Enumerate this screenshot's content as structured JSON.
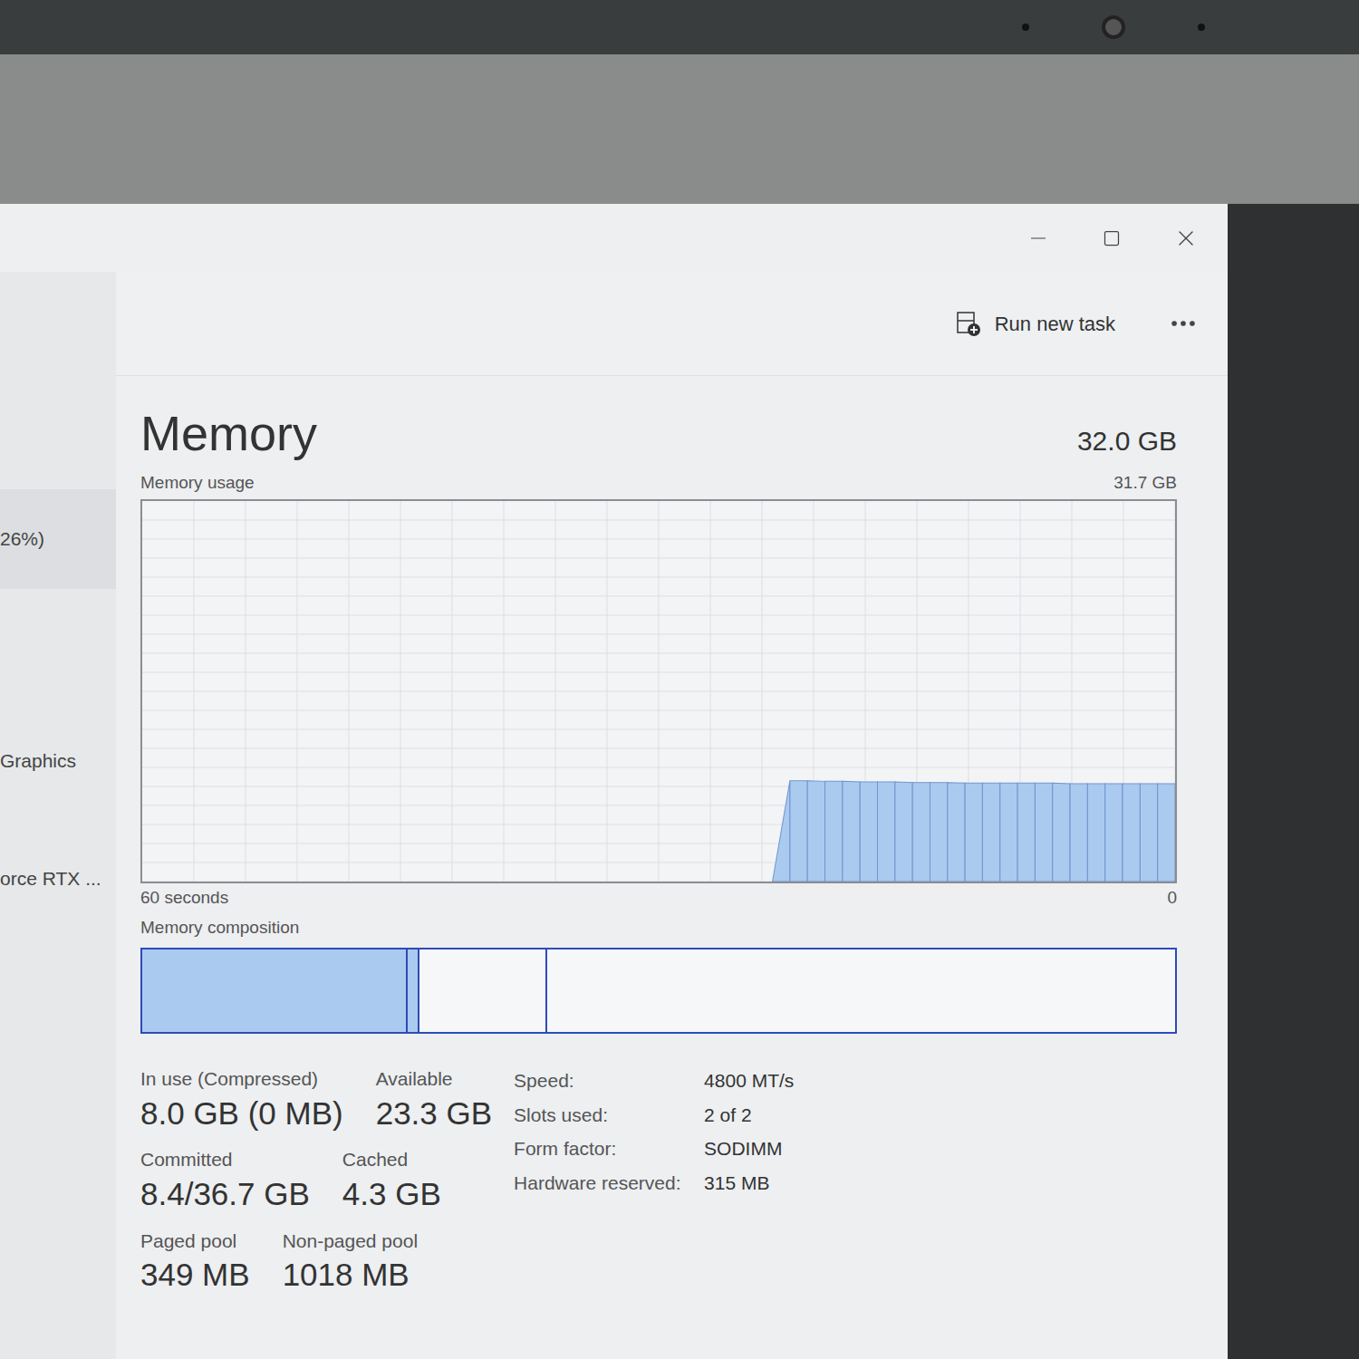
{
  "sidebar": {
    "items": [
      {
        "label": "26%)",
        "selected": true
      },
      {
        "label": "Graphics",
        "selected": false
      },
      {
        "label": "orce RTX ...",
        "selected": false
      }
    ]
  },
  "toolbar": {
    "run_task": "Run new task"
  },
  "page": {
    "title": "Memory",
    "total": "32.0 GB"
  },
  "chart": {
    "label": "Memory usage",
    "max_label": "31.7 GB",
    "max": 31.7,
    "time_label": "60 seconds",
    "min_label": "0",
    "values": [
      0,
      0,
      0,
      0,
      0,
      0,
      0,
      0,
      0,
      0,
      0,
      0,
      0,
      0,
      0,
      0,
      0,
      0,
      0,
      0,
      0,
      0,
      0,
      0,
      0,
      0,
      0,
      0,
      0,
      0,
      0,
      0,
      0,
      0,
      0,
      0,
      0,
      8.4,
      8.4,
      8.35,
      8.35,
      8.3,
      8.3,
      8.3,
      8.25,
      8.25,
      8.25,
      8.2,
      8.2,
      8.2,
      8.2,
      8.2,
      8.2,
      8.15,
      8.15,
      8.15,
      8.15,
      8.15,
      8.15,
      8.15
    ]
  },
  "composition": {
    "label": "Memory composition",
    "segments": [
      {
        "level": 0.255,
        "filled": true
      },
      {
        "level": 0.012,
        "filled": true
      },
      {
        "level": 0.123,
        "filled": false
      },
      {
        "level": 0.61,
        "filled": false
      }
    ]
  },
  "stats": [
    [
      {
        "label": "In use (Compressed)",
        "value": "8.0 GB (0 MB)"
      },
      {
        "label": "Available",
        "value": "23.3 GB"
      }
    ],
    [
      {
        "label": "Committed",
        "value": "8.4/36.7 GB"
      },
      {
        "label": "Cached",
        "value": "4.3 GB"
      }
    ],
    [
      {
        "label": "Paged pool",
        "value": "349 MB"
      },
      {
        "label": "Non-paged pool",
        "value": "1018 MB"
      }
    ]
  ],
  "details": [
    {
      "label": "Speed:",
      "value": "4800 MT/s"
    },
    {
      "label": "Slots used:",
      "value": "2 of 2"
    },
    {
      "label": "Form factor:",
      "value": "SODIMM"
    },
    {
      "label": "Hardware reserved:",
      "value": "315 MB"
    }
  ]
}
